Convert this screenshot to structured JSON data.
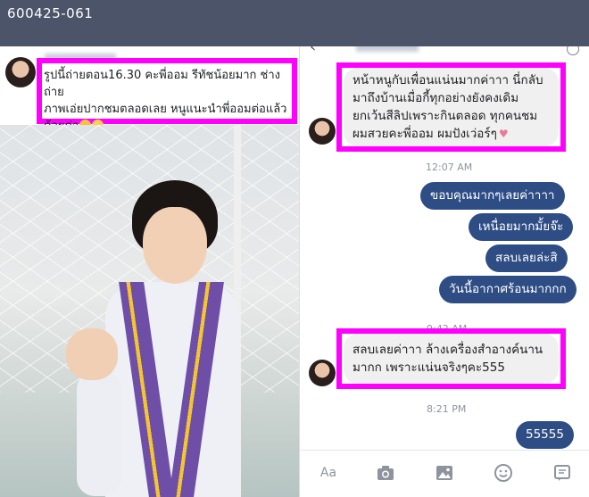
{
  "header": {
    "code": "600425-061"
  },
  "post": {
    "caption_line1": "รูปนี้ถ่ายตอน16.30 คะพี่ออม รีทัชน้อยมาก ช่างถ่าย",
    "caption_line2": "ภาพเอ่ยปากชมตลอดเลย หนูแนะนำพี่ออมต่อแล้ว",
    "caption_line3": "ด้วยค่า"
  },
  "chat": {
    "messages": {
      "recv1_line1": "หน้าหนูกับเพื่อนแน่นมากค่าาา นี่กลับ",
      "recv1_line2": "มาถึงบ้านเมื่อกี้ทุกอย่างยังคงเดิม",
      "recv1_line3": "ยกเว้นสีลิปเพราะกินตลอด ทุกคนชม",
      "recv1_line4": "ผมสวยคะพี่ออม ผมปังเว่อร์ๆ",
      "time1": "12:07 AM",
      "sent1": "ขอบคุณมากๆเลยค่าาาา",
      "sent2": "เหนื่อยมากมั้ยจ๊ะ",
      "sent3": "สลบเลยล่ะสิ",
      "sent4": "วันนี้อากาศร้อนมากกก",
      "time2": "9:42 AM",
      "recv2_line1": "สลบเลยค่าาา ล้างเครื่องสำอางค์นาน",
      "recv2_line2": "มากก เพราะแน่นจริงๆคะ555",
      "time3": "8:21 PM",
      "sent5": "55555"
    },
    "toolbar": {
      "text_button": "Aa"
    }
  },
  "colors": {
    "highlight": "#ff00ff",
    "sent_bubble": "#2e4d85",
    "topbar": "#4b5468"
  }
}
